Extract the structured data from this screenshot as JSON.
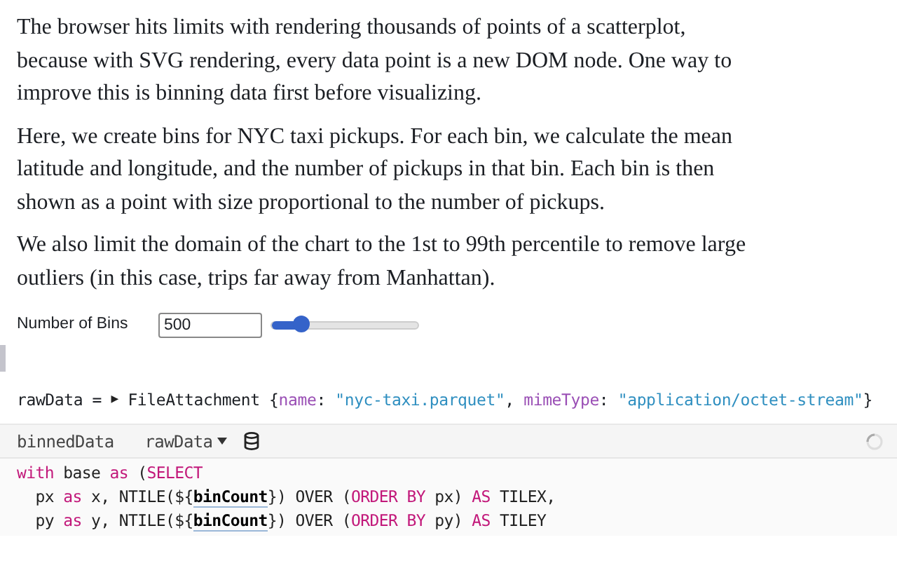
{
  "paragraphs": [
    "The browser hits limits with rendering thousands of points of a scatterplot, because with SVG rendering, every data point is a new DOM node. One way to improve this is binning data first before visualizing.",
    "Here, we create bins for NYC taxi pickups. For each bin, we calculate the mean latitude and longitude, and the number of pickups in that bin. Each bin is then shown as a point with size proportional to the number of pickups.",
    "We also limit the domain of the chart to the 1st to 99th percentile to remove large outliers (in this case, trips far away from Manhattan)."
  ],
  "input": {
    "label": "Number of Bins",
    "value": "500",
    "level": 0.2
  },
  "output": {
    "tokens": [
      {
        "kind": "plain",
        "text": "rawData = "
      },
      {
        "kind": "toggle",
        "text": "▶"
      },
      {
        "kind": "plain",
        "text": " FileAttachment {"
      },
      {
        "kind": "key",
        "text": "name"
      },
      {
        "kind": "plain",
        "text": ": "
      },
      {
        "kind": "string",
        "text": "\"nyc-taxi.parquet\""
      },
      {
        "kind": "plain",
        "text": ", "
      },
      {
        "kind": "key",
        "text": "mimeType"
      },
      {
        "kind": "plain",
        "text": ": "
      },
      {
        "kind": "string",
        "text": "\"application/octet-stream\""
      },
      {
        "kind": "plain",
        "text": "}"
      }
    ]
  },
  "cell": {
    "name": "binnedData",
    "source": "rawData",
    "code": [
      [
        {
          "kind": "keyword",
          "text": "with"
        },
        {
          "kind": "plain",
          "text": " base "
        },
        {
          "kind": "keyword",
          "text": "as"
        },
        {
          "kind": "plain",
          "text": " ("
        },
        {
          "kind": "keyword",
          "text": "SELECT"
        }
      ],
      [
        {
          "kind": "plain",
          "text": "  px "
        },
        {
          "kind": "keyword",
          "text": "as"
        },
        {
          "kind": "plain",
          "text": " x, NTILE(${"
        },
        {
          "kind": "variable",
          "text": "binCount"
        },
        {
          "kind": "plain",
          "text": "}) OVER ("
        },
        {
          "kind": "keyword",
          "text": "ORDER BY"
        },
        {
          "kind": "plain",
          "text": " px) "
        },
        {
          "kind": "keyword",
          "text": "AS"
        },
        {
          "kind": "plain",
          "text": " TILEX,"
        }
      ],
      [
        {
          "kind": "plain",
          "text": "  py "
        },
        {
          "kind": "keyword",
          "text": "as"
        },
        {
          "kind": "plain",
          "text": " y, NTILE(${"
        },
        {
          "kind": "variable",
          "text": "binCount"
        },
        {
          "kind": "plain",
          "text": "}) OVER ("
        },
        {
          "kind": "keyword",
          "text": "ORDER BY"
        },
        {
          "kind": "plain",
          "text": " py) "
        },
        {
          "kind": "keyword",
          "text": "AS"
        },
        {
          "kind": "plain",
          "text": " TILEY"
        }
      ]
    ]
  }
}
